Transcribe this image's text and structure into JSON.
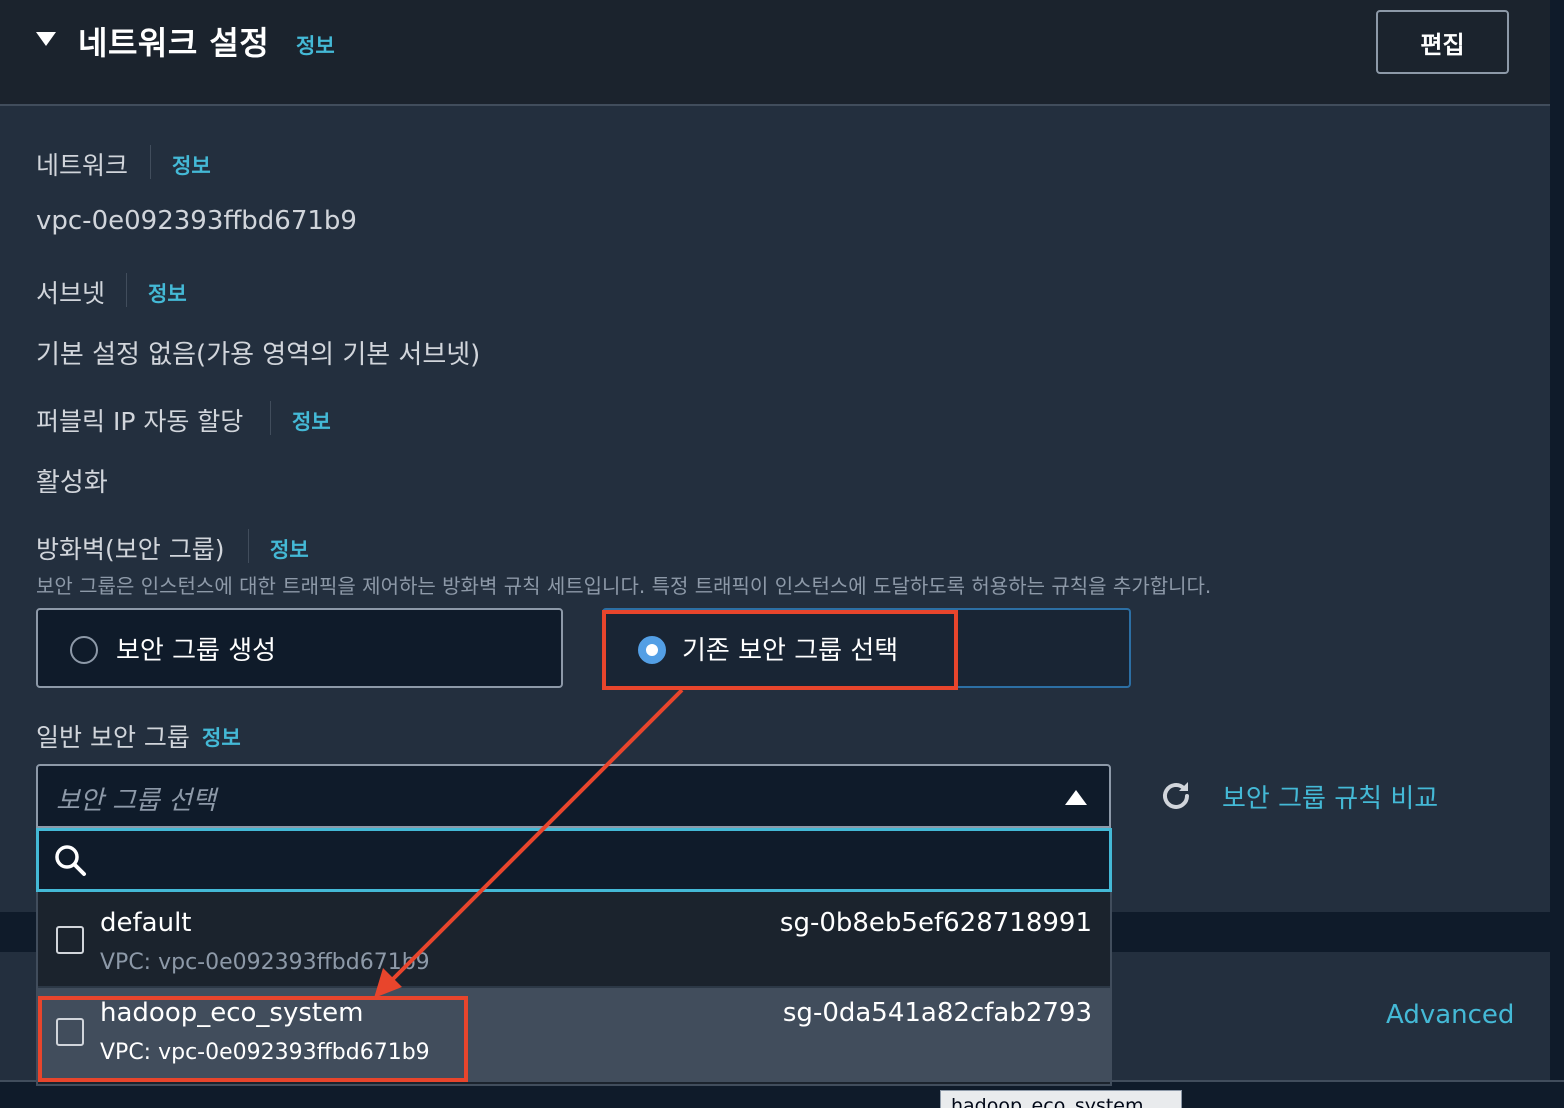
{
  "header": {
    "title": "네트워크 설정",
    "info_link": "정보",
    "edit_button": "편집"
  },
  "network": {
    "label": "네트워크",
    "info_link": "정보",
    "value": "vpc-0e092393ffbd671b9"
  },
  "subnet": {
    "label": "서브넷",
    "info_link": "정보",
    "value": "기본 설정 없음(가용 영역의 기본 서브넷)"
  },
  "public_ip": {
    "label": "퍼블릭 IP 자동 할당",
    "info_link": "정보",
    "value": "활성화"
  },
  "firewall": {
    "label": "방화벽(보안 그룹)",
    "info_link": "정보",
    "description": "보안 그룹은 인스턴스에 대한 트래픽을 제어하는 방화벽 규칙 세트입니다. 특정 트래픽이 인스턴스에 도달하도록 허용하는 규칙을 추가합니다.",
    "options": [
      {
        "label": "보안 그룹 생성",
        "selected": false
      },
      {
        "label": "기존 보안 그룹 선택",
        "selected": true
      }
    ]
  },
  "common_sg": {
    "label": "일반 보안 그룹",
    "info_link": "정보",
    "placeholder": "보안 그룹 선택",
    "compare_link": "보안 그룹 규칙 비교",
    "search_value": "",
    "items": [
      {
        "name": "default",
        "vpc": "VPC: vpc-0e092393ffbd671b9",
        "sg_id": "sg-0b8eb5ef628718991",
        "checked": false
      },
      {
        "name": "hadoop_eco_system",
        "vpc": "VPC: vpc-0e092393ffbd671b9",
        "sg_id": "sg-0da541a82cfab2793",
        "checked": false
      }
    ]
  },
  "advanced_link": "Advanced",
  "tooltip": "hadoop_eco_system",
  "colors": {
    "link": "#44b9d6",
    "highlight": "#e8452c",
    "selected_radio": "#539fe5",
    "focus_border": "#44b9d6"
  }
}
